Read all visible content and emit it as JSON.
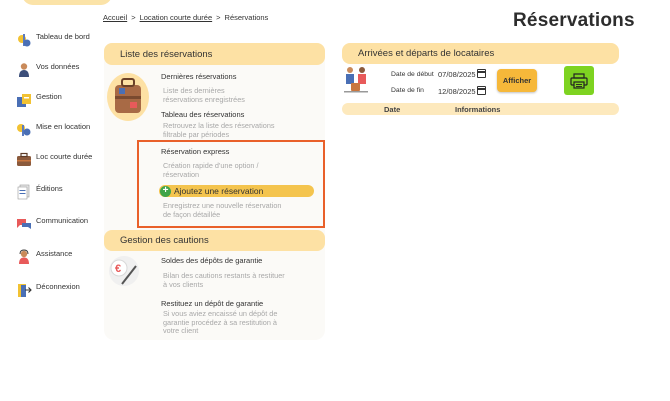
{
  "breadcrumb": {
    "home": "Accueil",
    "section": "Location courte durée",
    "current": "Réservations",
    "separator": ">"
  },
  "page_title": "Réservations",
  "sidebar": {
    "items": [
      {
        "label": "Tableau de bord",
        "icon": "dashboard-icon"
      },
      {
        "label": "Vos données",
        "icon": "user-data-icon"
      },
      {
        "label": "Gestion",
        "icon": "management-icon"
      },
      {
        "label": "Mise en location",
        "icon": "rental-listing-icon"
      },
      {
        "label": "Loc courte durée",
        "icon": "suitcase-icon"
      },
      {
        "label": "Éditions",
        "icon": "documents-icon"
      },
      {
        "label": "Communication",
        "icon": "chat-icon"
      },
      {
        "label": "Assistance",
        "icon": "support-icon"
      },
      {
        "label": "Déconnexion",
        "icon": "logout-icon"
      }
    ]
  },
  "reservations_list": {
    "header": "Liste des réservations",
    "latest_title": "Dernières réservations",
    "latest_desc_1": "Liste des dernières",
    "latest_desc_2": "réservations enregistrées",
    "table_title": "Tableau des réservations",
    "table_desc_1": "Retrouvez la liste des réservations",
    "table_desc_2": "filtrable par périodes",
    "express_title": "Réservation express",
    "express_desc_1": "Création rapide d'une option /",
    "express_desc_2": "réservation",
    "add_button": "Ajoutez une réservation",
    "add_button_icon": "+",
    "detailed_desc_1": "Enregistrez une nouvelle réservation",
    "detailed_desc_2": "de façon détaillée"
  },
  "deposits": {
    "header": "Gestion des cautions",
    "balance_title": "Soldes des dépôts de garantie",
    "balance_desc_1": "Bilan des cautions restants à restituer",
    "balance_desc_2": "à vos clients",
    "refund_title": "Restituez un dépôt de garantie",
    "refund_desc_1": "Si vous aviez encaissé un dépôt de",
    "refund_desc_2": "garantie procédez à sa restitution à",
    "refund_desc_3": "votre client"
  },
  "arrivals": {
    "header": "Arrivées et départs de locataires",
    "start_label": "Date de début",
    "start_value": "07/08/2025",
    "end_label": "Date de fin",
    "end_value": "12/08/2025",
    "show_button": "Afficher",
    "table_headers": {
      "date": "Date",
      "info": "Informations"
    }
  },
  "colors": {
    "panel_header": "#fde1a4",
    "highlight_border": "#e9602a",
    "add_button": "#f4c44e",
    "show_button": "#f6b83a",
    "print_button": "#7ed321"
  }
}
